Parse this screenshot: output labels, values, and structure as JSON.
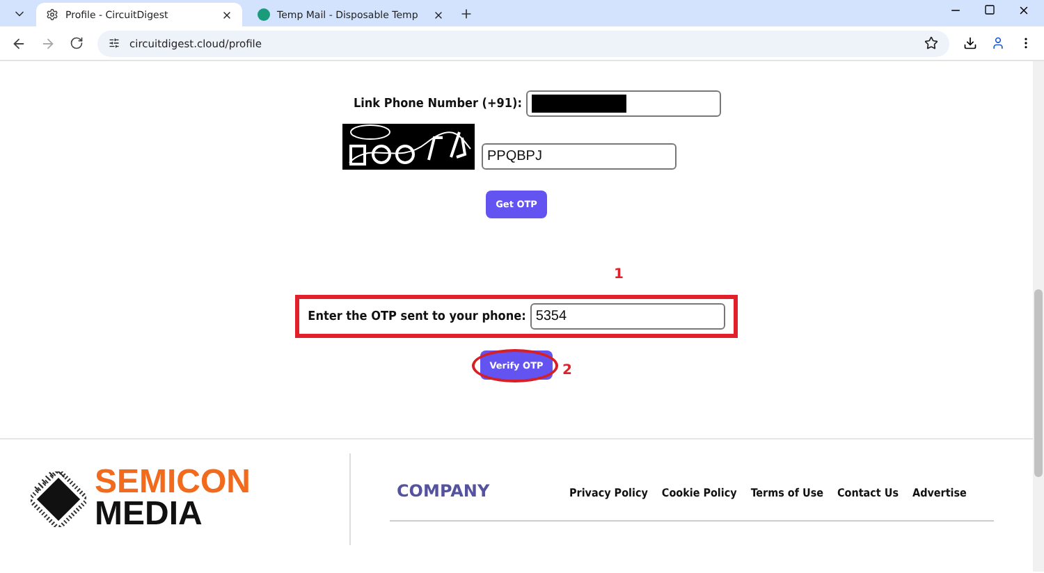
{
  "browser": {
    "tabs": [
      {
        "title": "Profile - CircuitDigest",
        "selected": true
      },
      {
        "title": "Temp Mail - Disposable Temp",
        "selected": false
      }
    ],
    "url": "circuitdigest.cloud/profile"
  },
  "form": {
    "phone_label": "Link Phone Number (+91):",
    "phone_redacted": true,
    "captcha_value": "PPQBPJ",
    "get_otp_button": "Get OTP",
    "otp_label": "Enter the OTP sent to your phone:",
    "otp_value": "5354",
    "verify_button": "Verify OTP"
  },
  "annotations": [
    {
      "label": "1"
    },
    {
      "label": "2"
    }
  ],
  "footer": {
    "logo_top": "SEMICON",
    "logo_bottom": "MEDIA",
    "heading": "COMPANY",
    "links": [
      "Privacy Policy",
      "Cookie Policy",
      "Terms of Use",
      "Contact Us",
      "Advertise"
    ]
  }
}
